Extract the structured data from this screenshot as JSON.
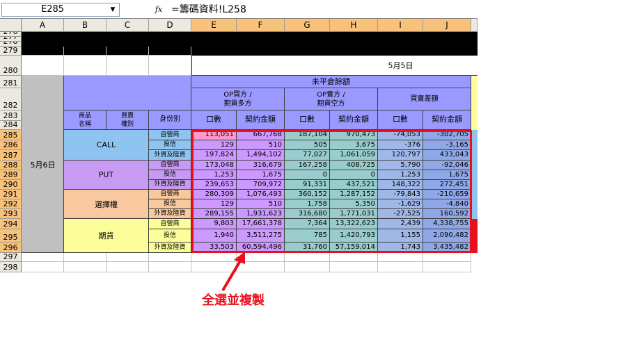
{
  "formula_bar": {
    "name_box": "E285",
    "fx_label": "fx",
    "formula": "=籌碼資料!L258"
  },
  "columns": [
    "A",
    "B",
    "C",
    "D",
    "E",
    "F",
    "G",
    "H",
    "I",
    "J"
  ],
  "selected_columns": [
    "E",
    "F",
    "G",
    "H",
    "I",
    "J"
  ],
  "rows": [
    "276",
    "277",
    "278",
    "279",
    "280",
    "281",
    "282",
    "283",
    "284",
    "285",
    "286",
    "287",
    "288",
    "289",
    "290",
    "291",
    "292",
    "293",
    "294",
    "295",
    "296",
    "297",
    "298"
  ],
  "selected_rows": [
    "285",
    "286",
    "287",
    "288",
    "289",
    "290",
    "291",
    "292",
    "293",
    "294",
    "295",
    "296"
  ],
  "sheet": {
    "date_top": "5月5日",
    "date_left": "5月6日",
    "title_unclosed": "未平倉餘額",
    "group_buy": "OP買方 /\n期貨多方",
    "group_sell": "OP賣方 /\n期貨空方",
    "group_diff": "買賣差額",
    "col_product": "商品\n名稱",
    "col_side": "買賣\n權別",
    "col_identity": "身份別",
    "col_qty": "口數",
    "col_amount": "契約金額",
    "products": [
      {
        "name": "CALL",
        "color": "#8fc4f0"
      },
      {
        "name": "PUT",
        "color": "#c79bf2"
      },
      {
        "name": "選擇權",
        "color": "#f8c89e"
      },
      {
        "name": "期貨",
        "color": "#fdfd9a"
      }
    ],
    "identities": [
      "自營商",
      "投信",
      "外資及陸資"
    ],
    "table": [
      [
        "113,051",
        "667,768",
        "187,104",
        "970,473",
        "-74,053",
        "-302,705"
      ],
      [
        "129",
        "510",
        "505",
        "3,675",
        "-376",
        "-3,165"
      ],
      [
        "197,824",
        "1,494,102",
        "77,027",
        "1,061,059",
        "120,797",
        "433,043"
      ],
      [
        "173,048",
        "316,679",
        "167,258",
        "408,725",
        "5,790",
        "-92,046"
      ],
      [
        "1,253",
        "1,675",
        "0",
        "0",
        "1,253",
        "1,675"
      ],
      [
        "239,653",
        "709,972",
        "91,331",
        "437,521",
        "148,322",
        "272,451"
      ],
      [
        "280,309",
        "1,076,493",
        "360,152",
        "1,287,152",
        "-79,843",
        "-210,659"
      ],
      [
        "129",
        "510",
        "1,758",
        "5,350",
        "-1,629",
        "-4,840"
      ],
      [
        "289,155",
        "1,931,623",
        "316,680",
        "1,771,031",
        "-27,525",
        "160,592"
      ],
      [
        "9,803",
        "17,661,378",
        "7,364",
        "13,322,623",
        "2,439",
        "4,338,755"
      ],
      [
        "1,940",
        "3,511,275",
        "785",
        "1,420,793",
        "1,155",
        "2,090,482"
      ],
      [
        "33,503",
        "60,594,496",
        "31,760",
        "57,159,014",
        "1,743",
        "3,435,482"
      ]
    ]
  },
  "annotation": "全選並複製",
  "colors": {
    "selection": "#e8101a",
    "header_blue": "#9999ff",
    "qty_buy": "#cc99ff",
    "data_teal": "#99cccc",
    "diff_green": "#c3d69b",
    "date_col": "#c0c0c0"
  }
}
